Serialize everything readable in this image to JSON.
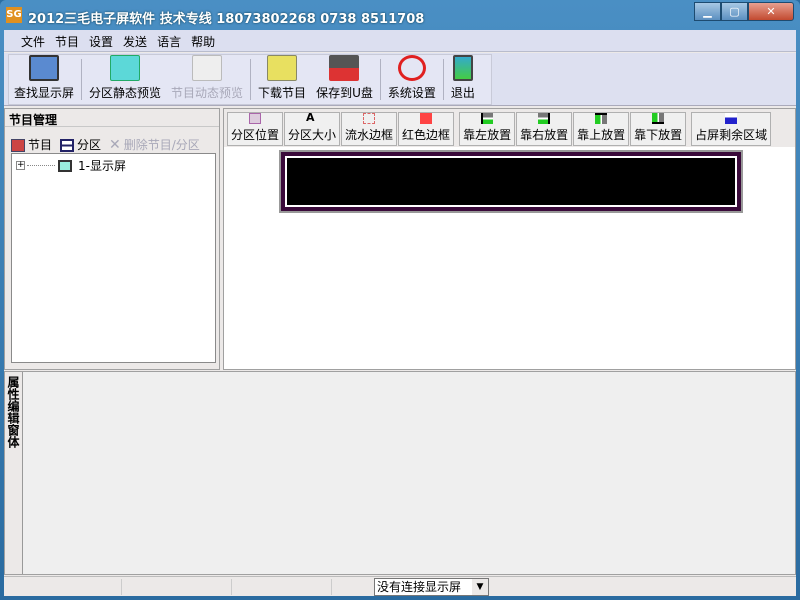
{
  "window": {
    "title": "2012三毛电子屏软件 技术专线 18073802268  0738 8511708",
    "icon_text": "SG",
    "controls": [
      "minimize",
      "maximize",
      "close"
    ]
  },
  "menu": [
    "文件",
    "节目",
    "设置",
    "发送",
    "语言",
    "帮助"
  ],
  "toolbar": [
    {
      "label": "查找显示屏",
      "icon": "find-screen-icon",
      "enabled": true
    },
    {
      "label": "分区静态预览",
      "icon": "static-preview-icon",
      "enabled": true
    },
    {
      "label": "节目动态预览",
      "icon": "dynamic-preview-icon",
      "enabled": false
    },
    {
      "label": "下载节目",
      "icon": "download-folder-icon",
      "enabled": true
    },
    {
      "label": "保存到U盘",
      "icon": "usb-drive-icon",
      "enabled": true
    },
    {
      "label": "系统设置",
      "icon": "settings-forbidden-icon",
      "enabled": true
    },
    {
      "label": "退出",
      "icon": "exit-door-icon",
      "enabled": true
    }
  ],
  "left_panel": {
    "title": "节目管理",
    "add_program": "节目",
    "add_area": "分区",
    "delete": "删除节目/分区",
    "tree": [
      {
        "label": "1-显示屏"
      }
    ]
  },
  "area_toolbar": [
    "分区位置",
    "分区大小",
    "流水边框",
    "红色边框",
    "靠左放置",
    "靠右放置",
    "靠上放置",
    "靠下放置",
    "占屏剩余区域"
  ],
  "bottom_panel": {
    "tab": "属性编辑窗体"
  },
  "status": {
    "connection": "没有连接显示屏"
  },
  "colors": {
    "titlebar": "#2a6ba0",
    "led_screen": "#000000",
    "led_border": "#3a0a3a"
  }
}
